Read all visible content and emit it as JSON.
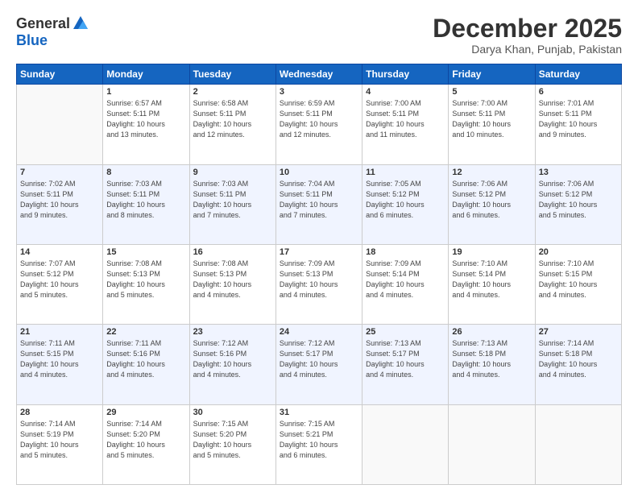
{
  "logo": {
    "general": "General",
    "blue": "Blue"
  },
  "header": {
    "month": "December 2025",
    "location": "Darya Khan, Punjab, Pakistan"
  },
  "days_of_week": [
    "Sunday",
    "Monday",
    "Tuesday",
    "Wednesday",
    "Thursday",
    "Friday",
    "Saturday"
  ],
  "weeks": [
    [
      {
        "day": "",
        "info": ""
      },
      {
        "day": "1",
        "info": "Sunrise: 6:57 AM\nSunset: 5:11 PM\nDaylight: 10 hours\nand 13 minutes."
      },
      {
        "day": "2",
        "info": "Sunrise: 6:58 AM\nSunset: 5:11 PM\nDaylight: 10 hours\nand 12 minutes."
      },
      {
        "day": "3",
        "info": "Sunrise: 6:59 AM\nSunset: 5:11 PM\nDaylight: 10 hours\nand 12 minutes."
      },
      {
        "day": "4",
        "info": "Sunrise: 7:00 AM\nSunset: 5:11 PM\nDaylight: 10 hours\nand 11 minutes."
      },
      {
        "day": "5",
        "info": "Sunrise: 7:00 AM\nSunset: 5:11 PM\nDaylight: 10 hours\nand 10 minutes."
      },
      {
        "day": "6",
        "info": "Sunrise: 7:01 AM\nSunset: 5:11 PM\nDaylight: 10 hours\nand 9 minutes."
      }
    ],
    [
      {
        "day": "7",
        "info": "Sunrise: 7:02 AM\nSunset: 5:11 PM\nDaylight: 10 hours\nand 9 minutes."
      },
      {
        "day": "8",
        "info": "Sunrise: 7:03 AM\nSunset: 5:11 PM\nDaylight: 10 hours\nand 8 minutes."
      },
      {
        "day": "9",
        "info": "Sunrise: 7:03 AM\nSunset: 5:11 PM\nDaylight: 10 hours\nand 7 minutes."
      },
      {
        "day": "10",
        "info": "Sunrise: 7:04 AM\nSunset: 5:11 PM\nDaylight: 10 hours\nand 7 minutes."
      },
      {
        "day": "11",
        "info": "Sunrise: 7:05 AM\nSunset: 5:12 PM\nDaylight: 10 hours\nand 6 minutes."
      },
      {
        "day": "12",
        "info": "Sunrise: 7:06 AM\nSunset: 5:12 PM\nDaylight: 10 hours\nand 6 minutes."
      },
      {
        "day": "13",
        "info": "Sunrise: 7:06 AM\nSunset: 5:12 PM\nDaylight: 10 hours\nand 5 minutes."
      }
    ],
    [
      {
        "day": "14",
        "info": "Sunrise: 7:07 AM\nSunset: 5:12 PM\nDaylight: 10 hours\nand 5 minutes."
      },
      {
        "day": "15",
        "info": "Sunrise: 7:08 AM\nSunset: 5:13 PM\nDaylight: 10 hours\nand 5 minutes."
      },
      {
        "day": "16",
        "info": "Sunrise: 7:08 AM\nSunset: 5:13 PM\nDaylight: 10 hours\nand 4 minutes."
      },
      {
        "day": "17",
        "info": "Sunrise: 7:09 AM\nSunset: 5:13 PM\nDaylight: 10 hours\nand 4 minutes."
      },
      {
        "day": "18",
        "info": "Sunrise: 7:09 AM\nSunset: 5:14 PM\nDaylight: 10 hours\nand 4 minutes."
      },
      {
        "day": "19",
        "info": "Sunrise: 7:10 AM\nSunset: 5:14 PM\nDaylight: 10 hours\nand 4 minutes."
      },
      {
        "day": "20",
        "info": "Sunrise: 7:10 AM\nSunset: 5:15 PM\nDaylight: 10 hours\nand 4 minutes."
      }
    ],
    [
      {
        "day": "21",
        "info": "Sunrise: 7:11 AM\nSunset: 5:15 PM\nDaylight: 10 hours\nand 4 minutes."
      },
      {
        "day": "22",
        "info": "Sunrise: 7:11 AM\nSunset: 5:16 PM\nDaylight: 10 hours\nand 4 minutes."
      },
      {
        "day": "23",
        "info": "Sunrise: 7:12 AM\nSunset: 5:16 PM\nDaylight: 10 hours\nand 4 minutes."
      },
      {
        "day": "24",
        "info": "Sunrise: 7:12 AM\nSunset: 5:17 PM\nDaylight: 10 hours\nand 4 minutes."
      },
      {
        "day": "25",
        "info": "Sunrise: 7:13 AM\nSunset: 5:17 PM\nDaylight: 10 hours\nand 4 minutes."
      },
      {
        "day": "26",
        "info": "Sunrise: 7:13 AM\nSunset: 5:18 PM\nDaylight: 10 hours\nand 4 minutes."
      },
      {
        "day": "27",
        "info": "Sunrise: 7:14 AM\nSunset: 5:18 PM\nDaylight: 10 hours\nand 4 minutes."
      }
    ],
    [
      {
        "day": "28",
        "info": "Sunrise: 7:14 AM\nSunset: 5:19 PM\nDaylight: 10 hours\nand 5 minutes."
      },
      {
        "day": "29",
        "info": "Sunrise: 7:14 AM\nSunset: 5:20 PM\nDaylight: 10 hours\nand 5 minutes."
      },
      {
        "day": "30",
        "info": "Sunrise: 7:15 AM\nSunset: 5:20 PM\nDaylight: 10 hours\nand 5 minutes."
      },
      {
        "day": "31",
        "info": "Sunrise: 7:15 AM\nSunset: 5:21 PM\nDaylight: 10 hours\nand 6 minutes."
      },
      {
        "day": "",
        "info": ""
      },
      {
        "day": "",
        "info": ""
      },
      {
        "day": "",
        "info": ""
      }
    ]
  ]
}
